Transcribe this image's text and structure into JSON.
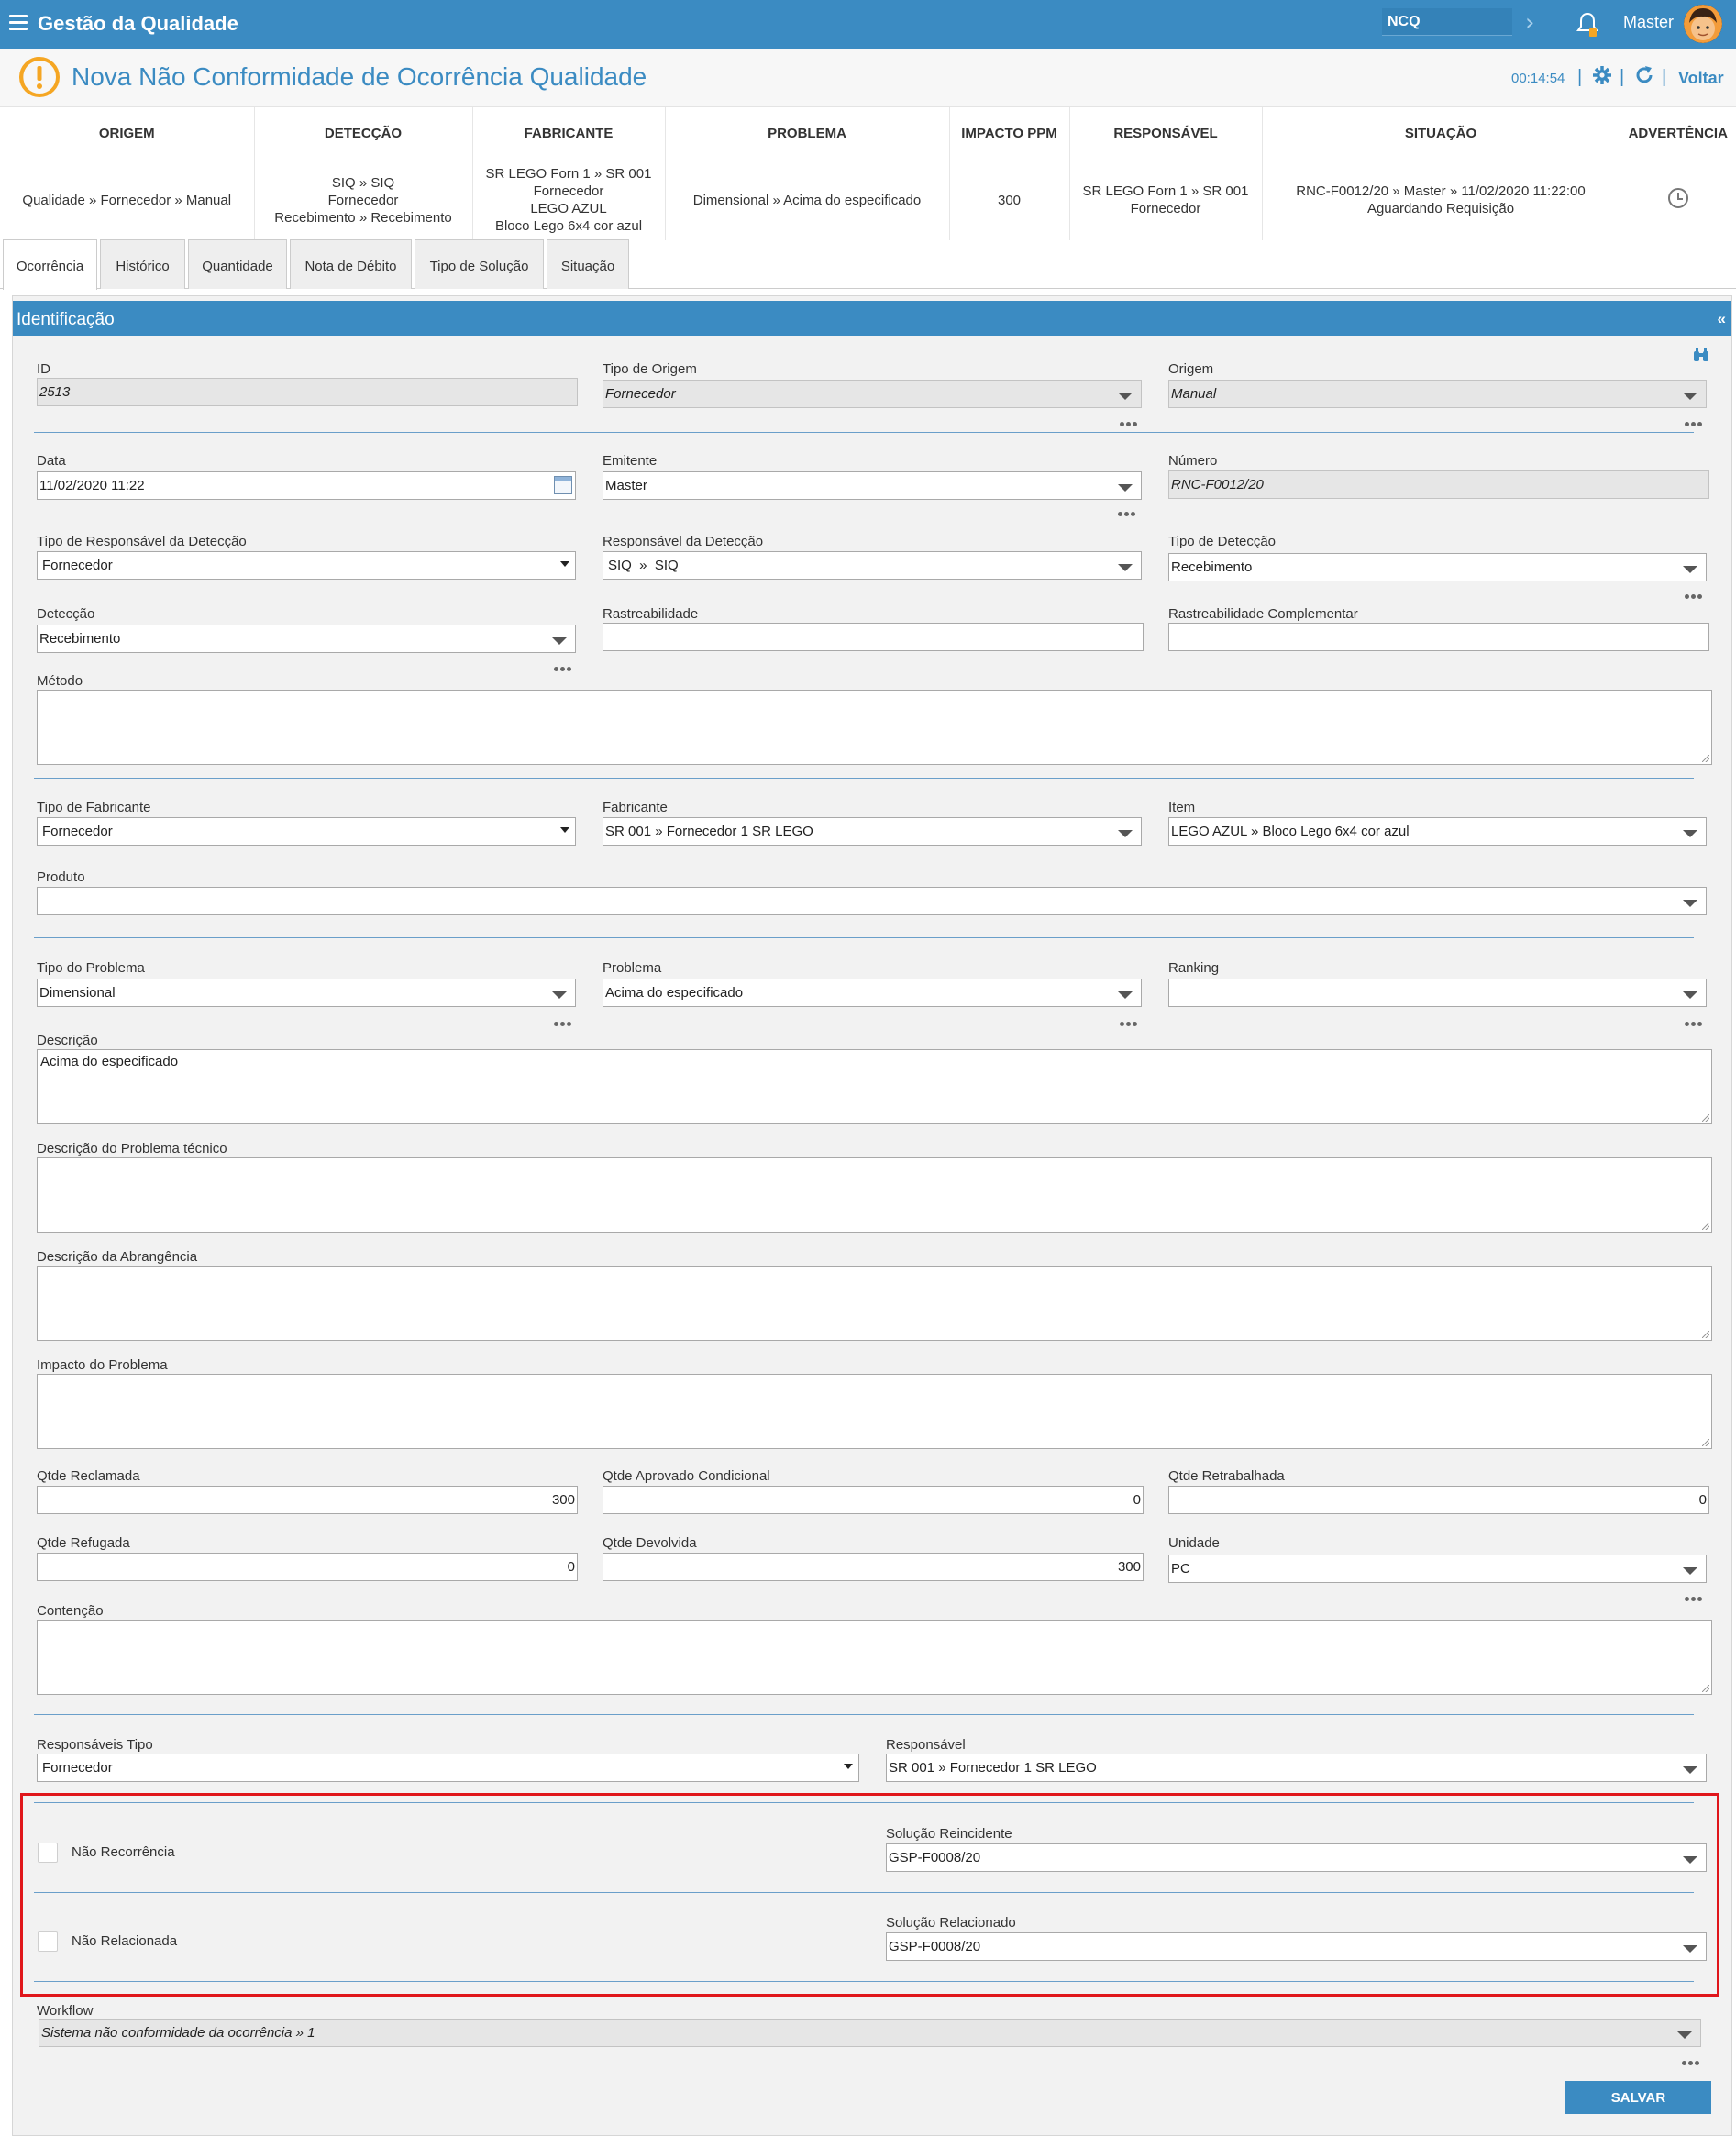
{
  "app": {
    "title": "Gestão da Qualidade",
    "module": "NCQ",
    "user": "Master"
  },
  "header": {
    "title": "Nova Não Conformidade de Ocorrência Qualidade",
    "timer": "00:14:54",
    "back_label": "Voltar"
  },
  "summary": {
    "columns": [
      "ORIGEM",
      "DETECÇÃO",
      "FABRICANTE",
      "PROBLEMA",
      "IMPACTO PPM",
      "RESPONSÁVEL",
      "SITUAÇÃO",
      "ADVERTÊNCIA"
    ],
    "row": {
      "origem": "Qualidade » Fornecedor » Manual",
      "deteccao": [
        "SIQ » SIQ",
        "Fornecedor",
        "Recebimento » Recebimento"
      ],
      "fabricante": [
        "SR LEGO Forn 1 » SR 001",
        "Fornecedor",
        "LEGO AZUL",
        "Bloco Lego 6x4 cor azul"
      ],
      "problema": "Dimensional » Acima do especificado",
      "impacto": "300",
      "responsavel": [
        "SR LEGO Forn 1 » SR 001",
        "Fornecedor"
      ],
      "situacao": [
        "RNC-F0012/20 » Master » 11/02/2020 11:22:00",
        "Aguardando Requisição"
      ]
    }
  },
  "tabs": [
    "Ocorrência",
    "Histórico",
    "Quantidade",
    "Nota de Débito",
    "Tipo de Solução",
    "Situação"
  ],
  "panel": {
    "title": "Identificação",
    "collapse": "«"
  },
  "fields": {
    "id": {
      "label": "ID",
      "value": "2513"
    },
    "tipo_origem": {
      "label": "Tipo de Origem",
      "value": "Fornecedor"
    },
    "origem": {
      "label": "Origem",
      "value": "Manual"
    },
    "data": {
      "label": "Data",
      "value": "11/02/2020 11:22"
    },
    "emitente": {
      "label": "Emitente",
      "value": "Master"
    },
    "numero": {
      "label": "Número",
      "value": "RNC-F0012/20"
    },
    "tipo_resp_deteccao": {
      "label": "Tipo de Responsável da Detecção",
      "value": "Fornecedor"
    },
    "resp_deteccao": {
      "label": "Responsável da Detecção",
      "value": "SIQ  »  SIQ"
    },
    "tipo_deteccao": {
      "label": "Tipo de Detecção",
      "value": "Recebimento"
    },
    "deteccao": {
      "label": "Detecção",
      "value": "Recebimento"
    },
    "rastreabilidade": {
      "label": "Rastreabilidade",
      "value": ""
    },
    "rastreabilidade_comp": {
      "label": "Rastreabilidade Complementar",
      "value": ""
    },
    "metodo": {
      "label": "Método",
      "value": ""
    },
    "tipo_fabricante": {
      "label": "Tipo de Fabricante",
      "value": "Fornecedor"
    },
    "fabricante": {
      "label": "Fabricante",
      "value": "SR 001 » Fornecedor 1 SR LEGO"
    },
    "item": {
      "label": "Item",
      "value": "LEGO AZUL » Bloco Lego 6x4 cor azul"
    },
    "produto": {
      "label": "Produto",
      "value": ""
    },
    "tipo_problema": {
      "label": "Tipo do Problema",
      "value": "Dimensional"
    },
    "problema": {
      "label": "Problema",
      "value": "Acima do especificado"
    },
    "ranking": {
      "label": "Ranking",
      "value": ""
    },
    "descricao": {
      "label": "Descrição",
      "value": "Acima do especificado"
    },
    "desc_tecnico": {
      "label": "Descrição do Problema técnico",
      "value": ""
    },
    "desc_abrangencia": {
      "label": "Descrição da Abrangência",
      "value": ""
    },
    "impacto": {
      "label": "Impacto do Problema",
      "value": ""
    },
    "qtde_reclamada": {
      "label": "Qtde Reclamada",
      "value": "300"
    },
    "qtde_aprovado": {
      "label": "Qtde Aprovado Condicional",
      "value": "0"
    },
    "qtde_retrabalhada": {
      "label": "Qtde Retrabalhada",
      "value": "0"
    },
    "qtde_refugada": {
      "label": "Qtde Refugada",
      "value": "0"
    },
    "qtde_devolvida": {
      "label": "Qtde Devolvida",
      "value": "300"
    },
    "unidade": {
      "label": "Unidade",
      "value": "PC"
    },
    "contencao": {
      "label": "Contenção",
      "value": ""
    },
    "resp_tipo": {
      "label": "Responsáveis Tipo",
      "value": "Fornecedor"
    },
    "responsavel": {
      "label": "Responsável",
      "value": "SR 001 » Fornecedor 1 SR LEGO"
    },
    "nao_recorrencia": {
      "label": "Não Recorrência"
    },
    "solucao_reincidente": {
      "label": "Solução Reincidente",
      "value": "GSP-F0008/20"
    },
    "nao_relacionada": {
      "label": "Não Relacionada"
    },
    "solucao_relacionado": {
      "label": "Solução Relacionado",
      "value": "GSP-F0008/20"
    },
    "workflow": {
      "label": "Workflow",
      "value": "Sistema não conformidade da ocorrência » 1"
    }
  },
  "actions": {
    "save": "SALVAR"
  },
  "colors": {
    "primary": "#3b8bc2",
    "highlight": "#e0161b",
    "warning": "#f5a623"
  }
}
